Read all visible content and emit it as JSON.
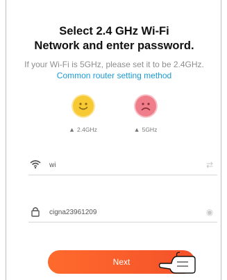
{
  "header": {
    "title_line1": "Select 2.4 GHz Wi-Fi",
    "title_line2": "Network and enter password."
  },
  "description": {
    "text": "If your Wi-Fi is 5GHz, please set it to be 2.4GHz.",
    "link": "Common router setting method"
  },
  "bands": [
    {
      "label": "2.4GHz",
      "face": "smile",
      "icon": "router-icon"
    },
    {
      "label": "5GHz",
      "face": "frown",
      "icon": "router-icon"
    }
  ],
  "form": {
    "wifi_name": "wi",
    "password": "cigna23961209"
  },
  "actions": {
    "next_label": "Next"
  },
  "colors": {
    "accent": "#f4522a",
    "link": "#1a9ad6",
    "good": "#f6c935",
    "bad": "#ef7d8a"
  }
}
